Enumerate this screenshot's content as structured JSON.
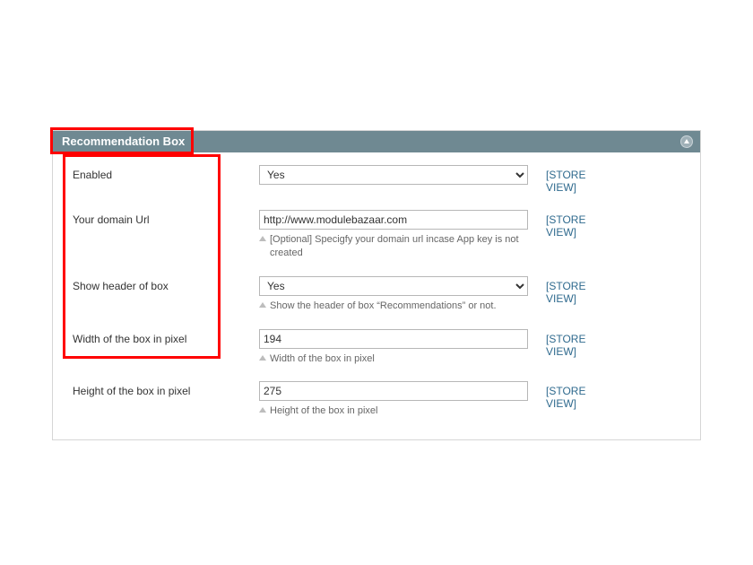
{
  "section": {
    "title": "Recommendation Box"
  },
  "scope": {
    "store_view": "[STORE VIEW]"
  },
  "fields": {
    "enabled": {
      "label": "Enabled",
      "value": "Yes"
    },
    "domain": {
      "label": "Your domain Url",
      "value": "http://www.modulebazaar.com",
      "hint": "[Optional] Specigfy your domain url incase App key is not created"
    },
    "show_header": {
      "label": "Show header of box",
      "value": "Yes",
      "hint": "Show the header of box “Recommendations” or not."
    },
    "width": {
      "label": "Width of the box in pixel",
      "value": "194",
      "hint": "Width of the box in pixel"
    },
    "height": {
      "label": "Height of the box in pixel",
      "value": "275",
      "hint": "Height of the box in pixel"
    }
  }
}
